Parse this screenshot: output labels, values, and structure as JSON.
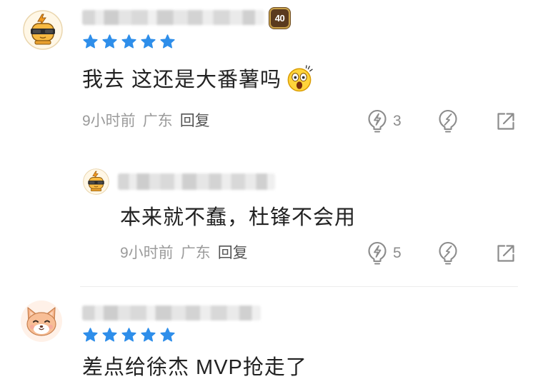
{
  "colors": {
    "star": "#2E8EEA",
    "text": "#222222",
    "meta": "#9B9B9B",
    "reply_label": "#555555",
    "icon": "#8C8C8C",
    "divider": "#EDEDED",
    "badge_bg": "#5A3A1E",
    "badge_ring": "#C9A24B"
  },
  "icons": {
    "like": "lightbulb-like-icon",
    "dislike": "lightbulb-dislike-icon",
    "share": "share-icon"
  },
  "comments": [
    {
      "avatar": "sunglasses-mascot-avatar",
      "level_badge": "40",
      "rating": 5,
      "text": "我去 这还是大番薯吗",
      "emoji": "astonished-face-emoji",
      "time": "9小时前",
      "location": "广东",
      "reply_label": "回复",
      "like_count": "3",
      "replies": [
        {
          "avatar": "sunglasses-mascot-avatar",
          "text": "本来就不蠢，杜锋不会用",
          "time": "9小时前",
          "location": "广东",
          "reply_label": "回复",
          "like_count": "5"
        }
      ]
    },
    {
      "avatar": "cat-face-avatar",
      "rating": 5,
      "text": "差点给徐杰 MVP抢走了"
    }
  ]
}
